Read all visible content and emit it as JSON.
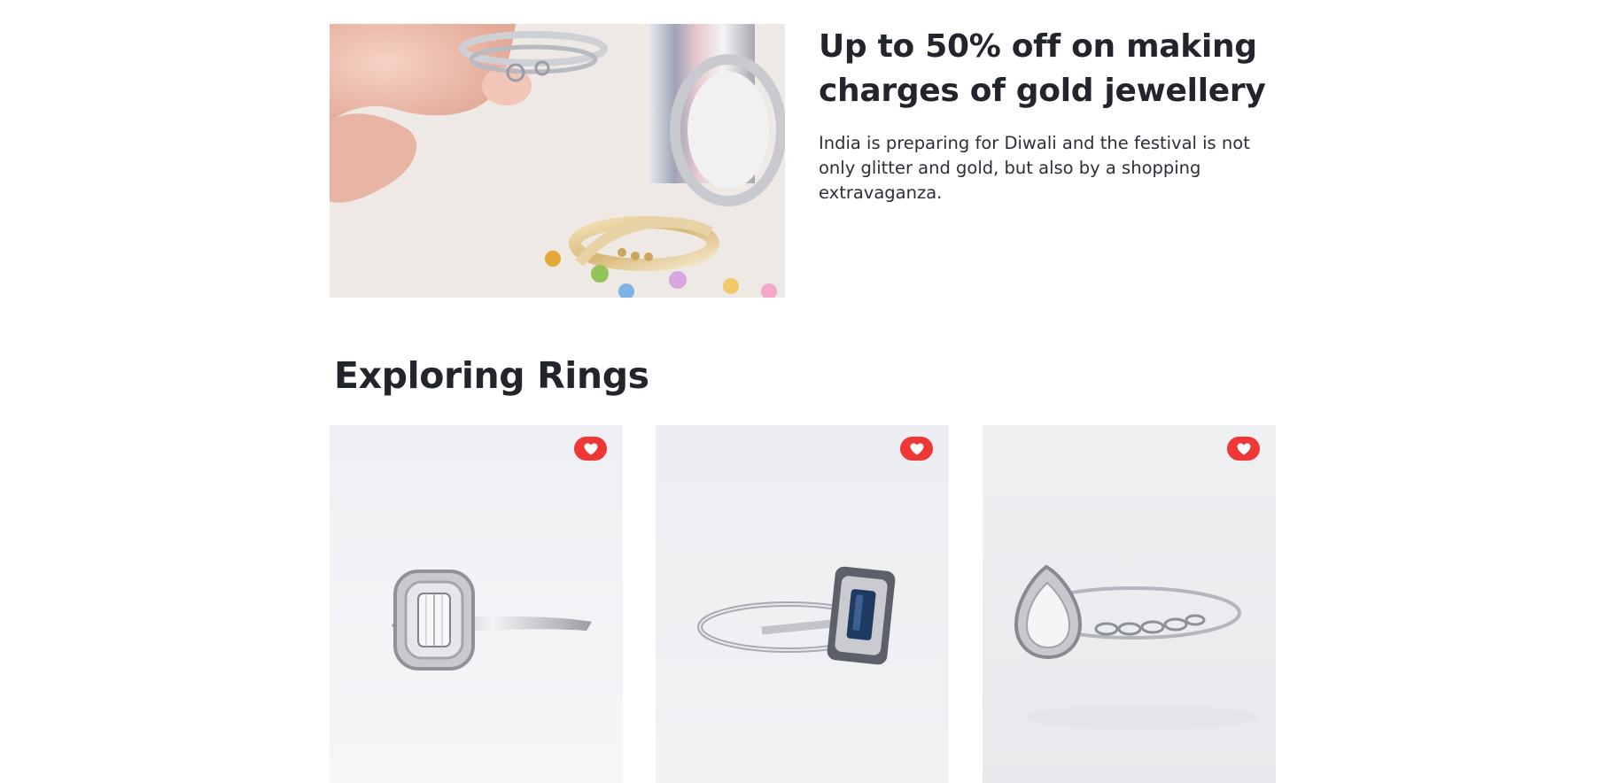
{
  "promo": {
    "title": "Up to 50% off on making charges of gold jewellery",
    "description": "India is preparing for Diwali and the festival is not only glitter and gold, but also by a shopping extravaganza."
  },
  "section": {
    "title": "Exploring Rings"
  },
  "products": [
    {
      "wishlist_icon": "heart-icon"
    },
    {
      "wishlist_icon": "heart-icon"
    },
    {
      "wishlist_icon": "heart-icon"
    }
  ],
  "colors": {
    "heading": "#22252b",
    "wishlist_badge": "#ef3737",
    "card_background": "#eef0f3"
  }
}
